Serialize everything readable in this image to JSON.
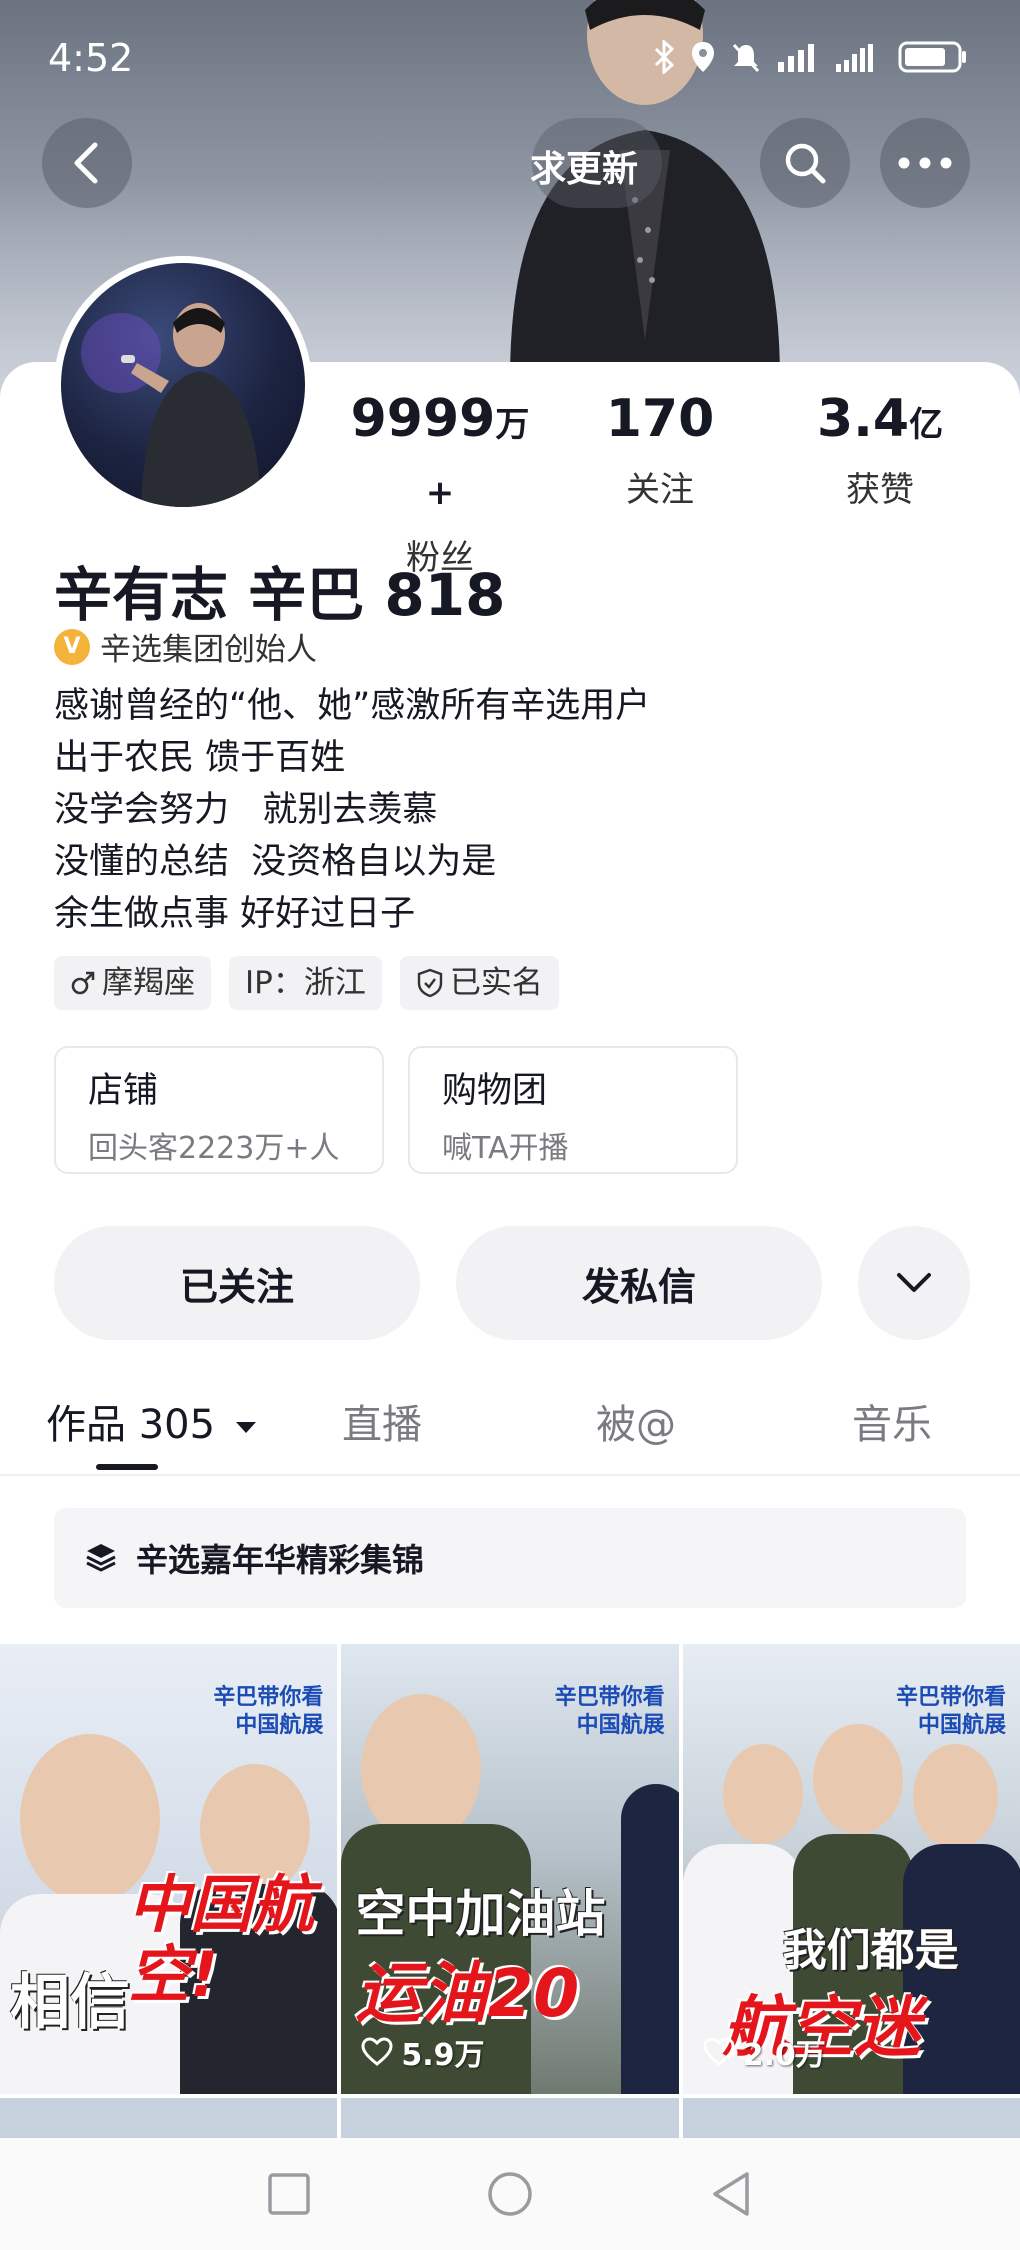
{
  "status_bar": {
    "time": "4:52",
    "battery_icon": "battery-icon"
  },
  "nav": {
    "title": "求更新",
    "back_icon": "back-arrow-icon",
    "search_icon": "search-icon",
    "more_icon": "more-dots-icon"
  },
  "profile": {
    "name": "辛有志 辛巴 818",
    "verified_label": "辛选集团创始人",
    "verified_badge": "V",
    "bio": [
      "感谢曾经的“他、她”感激所有辛选用户",
      "出于农民 馈于百姓",
      "没学会努力   就别去羡慕",
      "没懂的总结  没资格自以为是",
      "余生做点事 好好过日子"
    ],
    "stats": [
      {
        "num": "9999",
        "unit": "万+",
        "label": "粉丝"
      },
      {
        "num": "170",
        "unit": "",
        "label": "关注"
      },
      {
        "num": "3.4",
        "unit": "亿",
        "label": "获赞"
      }
    ],
    "tags": [
      {
        "icon": "male-icon",
        "text": "摩羯座"
      },
      {
        "icon": "",
        "text": "IP：浙江"
      },
      {
        "icon": "shield-icon",
        "text": "已实名"
      }
    ]
  },
  "shop_cards": [
    {
      "title": "店铺",
      "subtitle": "回头客2223万+人"
    },
    {
      "title": "购物团",
      "subtitle": "喊TA开播"
    }
  ],
  "actions": {
    "follow": "已关注",
    "message": "发私信",
    "more_icon": "chevron-down-icon"
  },
  "tabs": [
    {
      "label": "作品 305",
      "active": true
    },
    {
      "label": "直播",
      "active": false
    },
    {
      "label": "被@",
      "active": false
    },
    {
      "label": "音乐",
      "active": false
    }
  ],
  "collection": {
    "label": "辛选嘉年华精彩集锦",
    "icon": "layers-icon"
  },
  "videos": [
    {
      "brand_line1": "辛巴带你看",
      "brand_line2": "中国航展",
      "white_text": "相信",
      "red_text": "中国航空!",
      "likes": ""
    },
    {
      "brand_line1": "辛巴带你看",
      "brand_line2": "中国航展",
      "white_text": "空中加油站",
      "red_text": "运油20",
      "likes": "5.9万"
    },
    {
      "brand_line1": "辛巴带你看",
      "brand_line2": "中国航展",
      "white_text": "我们都是",
      "red_text": "航空迷",
      "likes": "2.0万"
    }
  ],
  "colors": {
    "accent_badge": "#f4b33a",
    "video_red": "#e4161c",
    "brand_blue": "#1b4bb5"
  }
}
